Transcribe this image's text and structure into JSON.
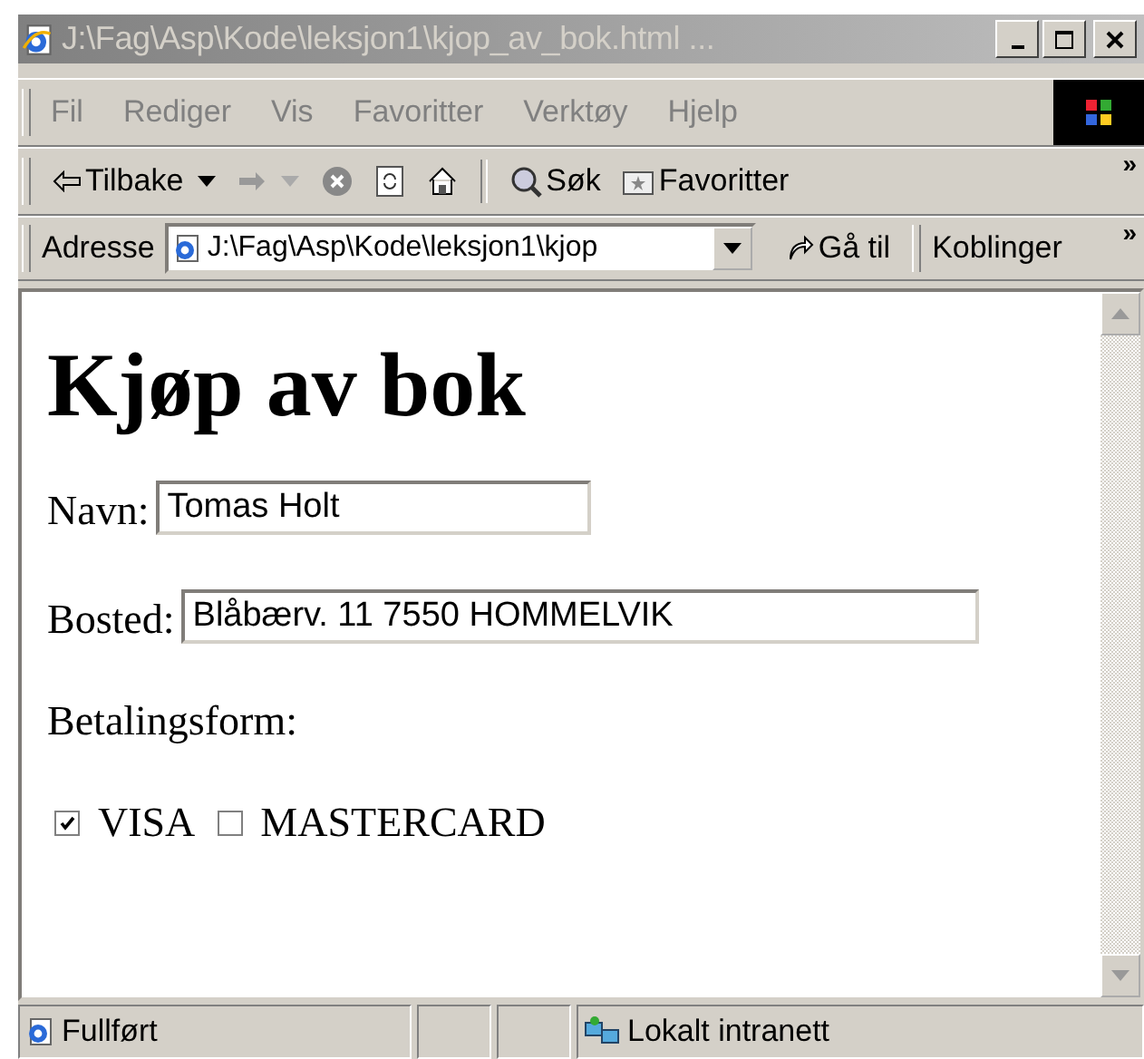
{
  "window": {
    "title": "J:\\Fag\\Asp\\Kode\\leksjon1\\kjop_av_bok.html ...",
    "active": false
  },
  "menu": [
    "Fil",
    "Rediger",
    "Vis",
    "Favoritter",
    "Verktøy",
    "Hjelp"
  ],
  "toolbar": {
    "back": "Tilbake",
    "search": "Søk",
    "favorites": "Favoritter",
    "more": "»"
  },
  "address_bar": {
    "label": "Adresse",
    "value": "J:\\Fag\\Asp\\Kode\\leksjon1\\kjop",
    "go": "Gå til",
    "links": "Koblinger",
    "more": "»"
  },
  "page": {
    "heading": "Kjøp av bok",
    "fields": [
      {
        "label": "Navn:",
        "value": "Tomas Holt",
        "kind": "short"
      },
      {
        "label": "Bosted:",
        "value": "Blåbærv. 11 7550 HOMMELVIK",
        "kind": "long"
      }
    ],
    "payment_label": "Betalingsform:",
    "options": [
      {
        "label": "VISA",
        "checked": true
      },
      {
        "label": "MASTERCARD",
        "checked": false
      }
    ]
  },
  "status_bar": {
    "status": "Fullført",
    "zone": "Lokalt intranett"
  }
}
